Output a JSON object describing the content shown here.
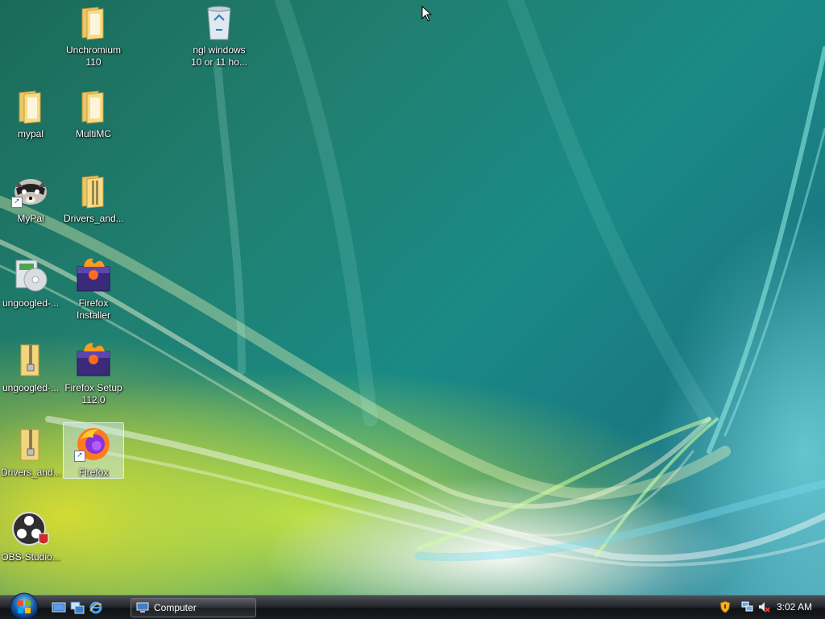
{
  "desktop": {
    "icons": [
      {
        "label": "Unchromium\n110",
        "icon": "folder-icon"
      },
      {
        "label": "ngl windows\n10 or 11 ho...",
        "icon": "recycle-bin-icon"
      },
      {
        "label": "mypal",
        "icon": "folder-icon"
      },
      {
        "label": "MultiMC",
        "icon": "folder-icon"
      },
      {
        "label": "MyPal",
        "icon": "mypal-raccoon-icon"
      },
      {
        "label": "Drivers_and...",
        "icon": "folder-icon"
      },
      {
        "label": "ungoogled-...",
        "icon": "installer-icon"
      },
      {
        "label": "Firefox\nInstaller",
        "icon": "firefox-installer-icon"
      },
      {
        "label": "ungoogled-...",
        "icon": "zip-folder-icon"
      },
      {
        "label": "Firefox Setup\n112.0",
        "icon": "firefox-installer-icon"
      },
      {
        "label": "Drivers_and...",
        "icon": "zip-folder-icon"
      },
      {
        "label": "Firefox",
        "icon": "firefox-icon"
      },
      {
        "label": "OBS-Studio...",
        "icon": "obs-studio-icon"
      }
    ]
  },
  "taskbar": {
    "start_icon": "windows-orb-icon",
    "quick_launch": [
      {
        "name": "show-desktop-icon"
      },
      {
        "name": "switch-windows-icon"
      },
      {
        "name": "internet-explorer-icon"
      }
    ],
    "tasks": [
      {
        "label": "Computer",
        "icon": "computer-icon"
      }
    ],
    "tray": {
      "icons": [
        "security-shield-icon",
        "network-icon",
        "volume-muted-icon"
      ],
      "clock": "3:02 AM"
    }
  },
  "colors": {
    "wallpaper_teal": "#1a8a86",
    "wallpaper_yellow": "#d8e53a",
    "taskbar": "#1b1e22",
    "selection": "#d2ebf5"
  }
}
